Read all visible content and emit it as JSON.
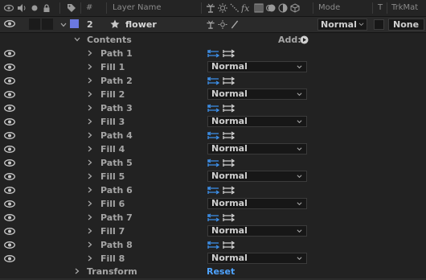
{
  "header": {
    "col_num": "#",
    "col_layer_name": "Layer Name",
    "col_mode": "Mode",
    "col_t": "T",
    "col_trkmat": "TrkMat"
  },
  "layer": {
    "index": "2",
    "name": "flower",
    "mode": "Normal",
    "trkmat": "None",
    "label_color": "#6b78e0"
  },
  "contents": {
    "label": "Contents",
    "add_label": "Add:"
  },
  "items": [
    {
      "name": "Path 1",
      "type": "path"
    },
    {
      "name": "Fill 1",
      "type": "fill",
      "mode": "Normal"
    },
    {
      "name": "Path 2",
      "type": "path"
    },
    {
      "name": "Fill 2",
      "type": "fill",
      "mode": "Normal"
    },
    {
      "name": "Path 3",
      "type": "path"
    },
    {
      "name": "Fill 3",
      "type": "fill",
      "mode": "Normal"
    },
    {
      "name": "Path 4",
      "type": "path"
    },
    {
      "name": "Fill 4",
      "type": "fill",
      "mode": "Normal"
    },
    {
      "name": "Path 5",
      "type": "path"
    },
    {
      "name": "Fill 5",
      "type": "fill",
      "mode": "Normal"
    },
    {
      "name": "Path 6",
      "type": "path"
    },
    {
      "name": "Fill 6",
      "type": "fill",
      "mode": "Normal"
    },
    {
      "name": "Path 7",
      "type": "path"
    },
    {
      "name": "Fill 7",
      "type": "fill",
      "mode": "Normal"
    },
    {
      "name": "Path 8",
      "type": "path"
    },
    {
      "name": "Fill 8",
      "type": "fill",
      "mode": "Normal"
    }
  ],
  "transform": {
    "label": "Transform",
    "reset_label": "Reset"
  },
  "colors": {
    "accent_blue": "#4ea3ff",
    "path_icon_blue": "#3d8fe8"
  }
}
